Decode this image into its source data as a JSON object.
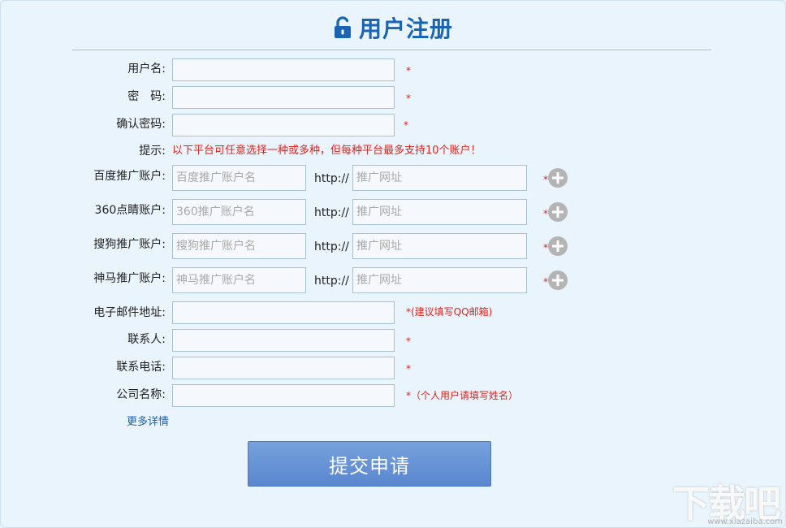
{
  "header": {
    "title": "用户注册",
    "icon": "unlock-icon",
    "accent_color": "#1a64b4"
  },
  "form": {
    "username": {
      "label": "用户名:",
      "value": "",
      "required_mark": "*"
    },
    "password": {
      "label": "密　码:",
      "value": "",
      "required_mark": "*"
    },
    "confirm_password": {
      "label": "确认密码:",
      "value": "",
      "required_mark": "*"
    },
    "hint": {
      "label": "提示:",
      "text": "以下平台可任意选择一种或多种，但每种平台最多支持10个账户！"
    },
    "platforms": [
      {
        "label": "百度推广账户:",
        "account_placeholder": "百度推广账户名",
        "prefix": "http://",
        "url_placeholder": "推广网址",
        "required_mark": "*",
        "add_icon": "plus-circle-icon"
      },
      {
        "label": "360点睛账户:",
        "account_placeholder": "360推广账户名",
        "prefix": "http://",
        "url_placeholder": "推广网址",
        "required_mark": "*",
        "add_icon": "plus-circle-icon"
      },
      {
        "label": "搜狗推广账户:",
        "account_placeholder": "搜狗推广账户名",
        "prefix": "http://",
        "url_placeholder": "推广网址",
        "required_mark": "*",
        "add_icon": "plus-circle-icon"
      },
      {
        "label": "神马推广账户:",
        "account_placeholder": "神马推广账户名",
        "prefix": "http://",
        "url_placeholder": "推广网址",
        "required_mark": "*",
        "add_icon": "plus-circle-icon"
      }
    ],
    "email": {
      "label": "电子邮件地址:",
      "value": "",
      "note": "*(建议填写QQ邮箱)"
    },
    "contact": {
      "label": "联系人:",
      "value": "",
      "required_mark": "*"
    },
    "phone": {
      "label": "联系电话:",
      "value": "",
      "required_mark": "*"
    },
    "company": {
      "label": "公司名称:",
      "value": "",
      "note": "*（个人用户请填写姓名）"
    },
    "more_link": "更多详情",
    "submit_label": "提交申请"
  },
  "watermark": {
    "text": "下载吧",
    "domain": "www.xiazaiba.com"
  }
}
